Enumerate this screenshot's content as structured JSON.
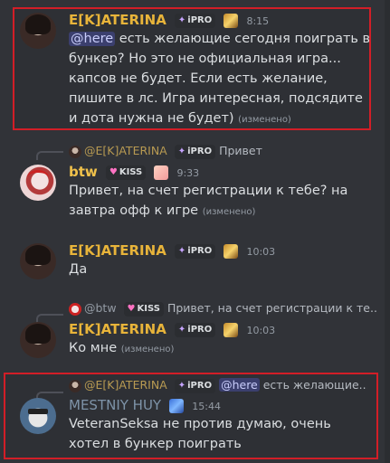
{
  "messages": [
    {
      "author": "E[K]ATERINA",
      "badge": "iPRO",
      "time": "8:15",
      "mention": "@here",
      "text": " есть желающие сегодня поиграть в бункер? Но это не официальная игра... капсов не будет. Если есть желание, пишите в лс. Игра интересная, подсядите и дота нужна не будет)",
      "edited": "(изменено)"
    },
    {
      "reply": {
        "author": "@E[K]ATERINA",
        "badge": "iPRO",
        "text": "Привет"
      },
      "author": "btw",
      "badge": "KISS",
      "time": "9:33",
      "text": "Привет, на счет регистрации к тебе? на завтра офф к игре",
      "edited": "(изменено)"
    },
    {
      "author": "E[K]ATERINA",
      "badge": "iPRO",
      "time": "10:03",
      "text": "Да"
    },
    {
      "reply": {
        "author": "@btw",
        "badge": "KISS",
        "text": "Привет, на счет регистрации к те..."
      },
      "author": "E[K]ATERINA",
      "badge": "iPRO",
      "time": "10:03",
      "text": "Ко мне",
      "edited": "(изменено)"
    },
    {
      "reply": {
        "author": "@E[K]ATERINA",
        "badge": "iPRO",
        "mention": "@here",
        "text": "есть желающие..."
      },
      "author": "MESTNIY HUY",
      "time": "15:44",
      "text": "VeteranSeksa не против думаю, очень хотел в бункер поиграть"
    }
  ],
  "colors": {
    "background": "#313338",
    "highlight_frame": "#d21e27",
    "name_ekaterina": "#e8b43a",
    "name_btw": "#f0c14b",
    "name_mestniy": "#7e93a8"
  }
}
